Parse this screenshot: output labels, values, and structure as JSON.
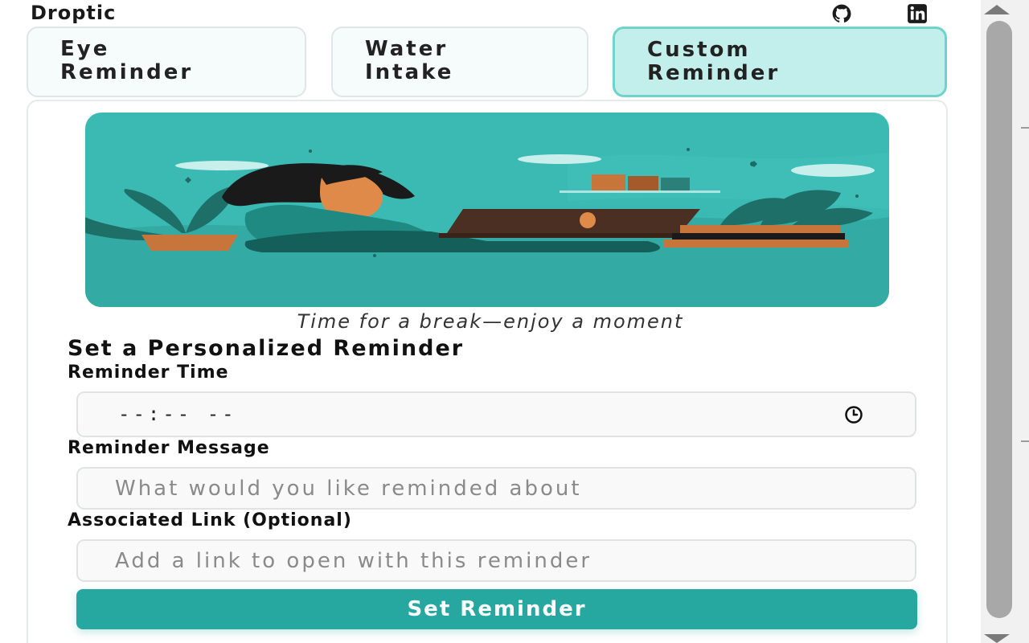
{
  "app": {
    "title": "Droptic"
  },
  "header_icons": {
    "github": "github-icon",
    "linkedin": "linkedin-icon"
  },
  "tabs": [
    {
      "line1": "Eye",
      "line2": "Reminder",
      "active": false
    },
    {
      "line1": "Water",
      "line2": "Intake",
      "active": false
    },
    {
      "line1": "Custom",
      "line2": "Reminder",
      "active": true
    }
  ],
  "illustration": {
    "caption": "Time for a break—enjoy a moment"
  },
  "form": {
    "title": "Set a Personalized Reminder",
    "time_label": "Reminder Time",
    "time_value": "--:-- --",
    "message_label": "Reminder Message",
    "message_placeholder": "What would you like reminded about",
    "link_label": "Associated Link (Optional)",
    "link_placeholder": "Add a link to open with this reminder",
    "submit_label": "Set Reminder"
  },
  "colors": {
    "accent": "#26a79f",
    "active_tab_bg": "#c2efec",
    "active_tab_border": "#6fd3cc",
    "illustration_bg": "#3bbab3"
  }
}
